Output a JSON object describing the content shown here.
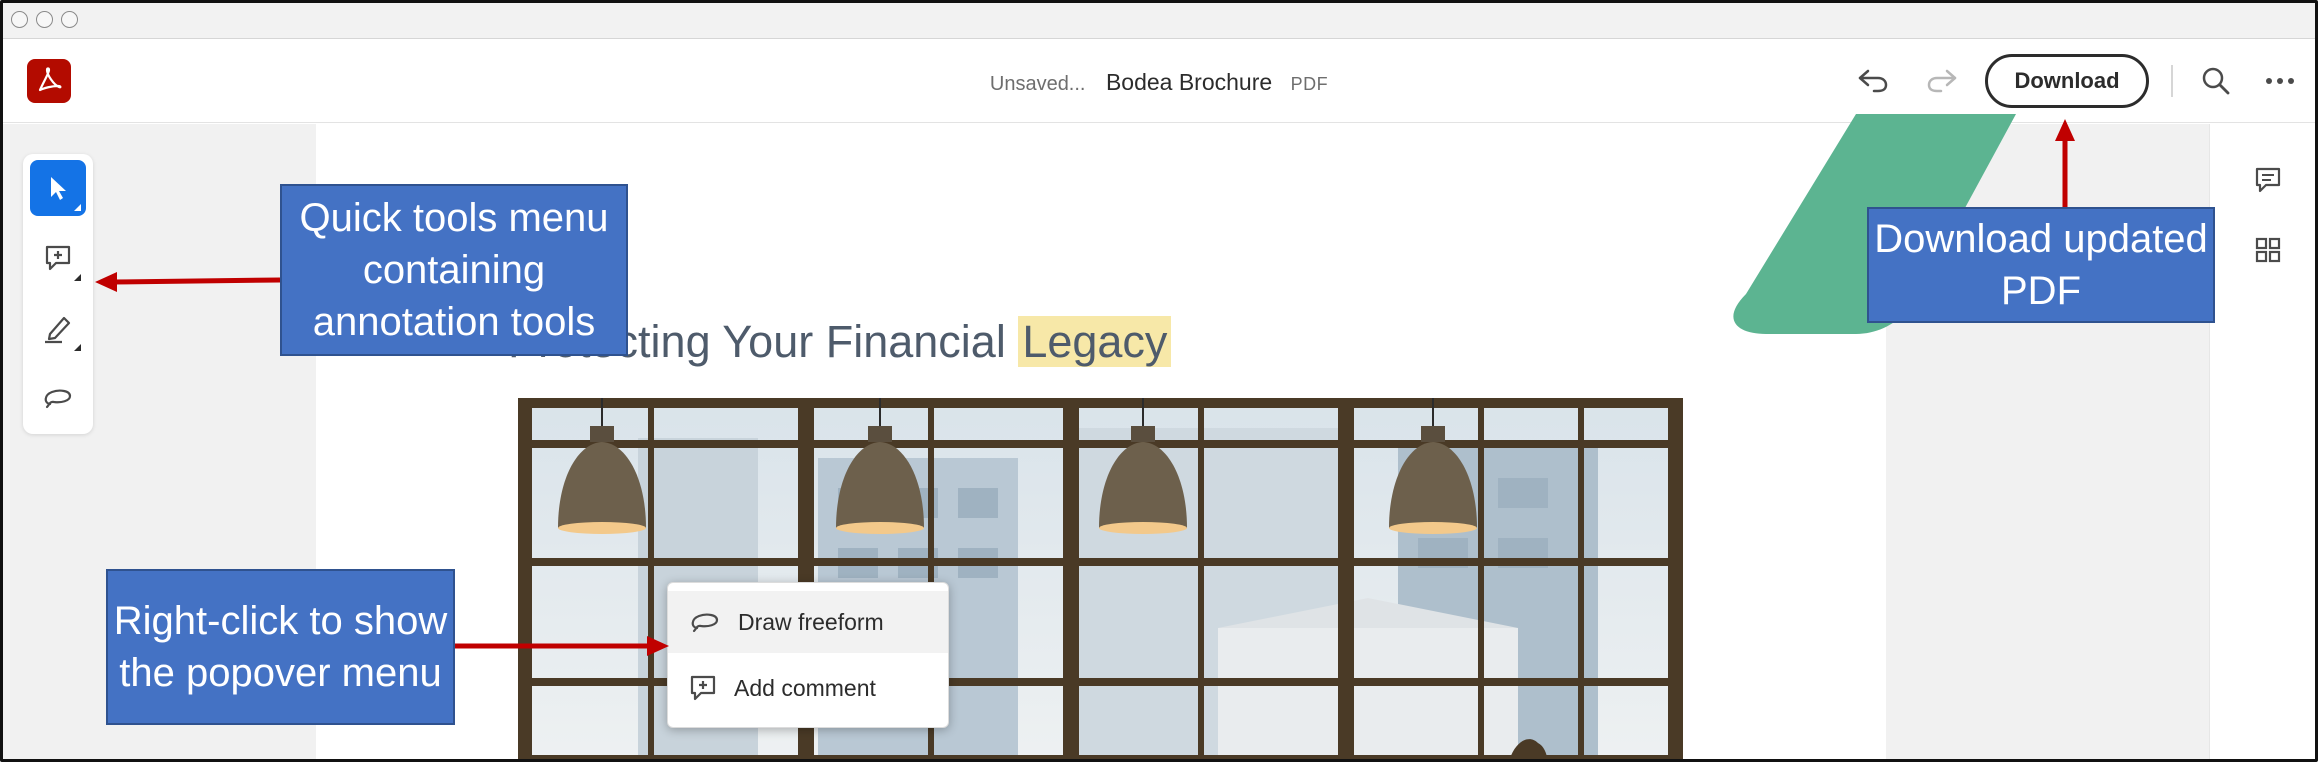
{
  "app": {
    "doc_status": "Unsaved...",
    "doc_name": "Bodea Brochure",
    "doc_type": "PDF",
    "download_label": "Download"
  },
  "icons": {
    "logo": "adobe-acrobat-icon",
    "undo": "undo-icon",
    "redo": "redo-icon",
    "search": "search-icon",
    "more": "more-icon",
    "comment": "comment-icon",
    "grid": "grid-icon"
  },
  "quick_tools": [
    {
      "name": "select-tool",
      "icon": "cursor-icon",
      "active": true
    },
    {
      "name": "add-comment-tool",
      "icon": "comment-add-icon",
      "active": false
    },
    {
      "name": "highlight-tool",
      "icon": "pen-icon",
      "active": false
    },
    {
      "name": "draw-freeform-tool",
      "icon": "lasso-icon",
      "active": false
    }
  ],
  "page": {
    "heading_prefix": "Protecting Your Financial ",
    "heading_highlight": "Legacy"
  },
  "popover": {
    "items": [
      {
        "label": "Draw freeform",
        "icon": "lasso-icon"
      },
      {
        "label": "Add comment",
        "icon": "comment-add-icon"
      }
    ]
  },
  "callouts": {
    "quick_tools": "Quick tools menu containing annotation tools",
    "download": "Download updated PDF",
    "right_click": "Right-click to show the popover menu"
  },
  "colors": {
    "accent": "#1473e6",
    "brand": "#b30b00",
    "callout_fill": "#4472c4",
    "arrow": "#c00000",
    "green_shape": "#5cb491",
    "highlight": "#f7e8a8"
  }
}
